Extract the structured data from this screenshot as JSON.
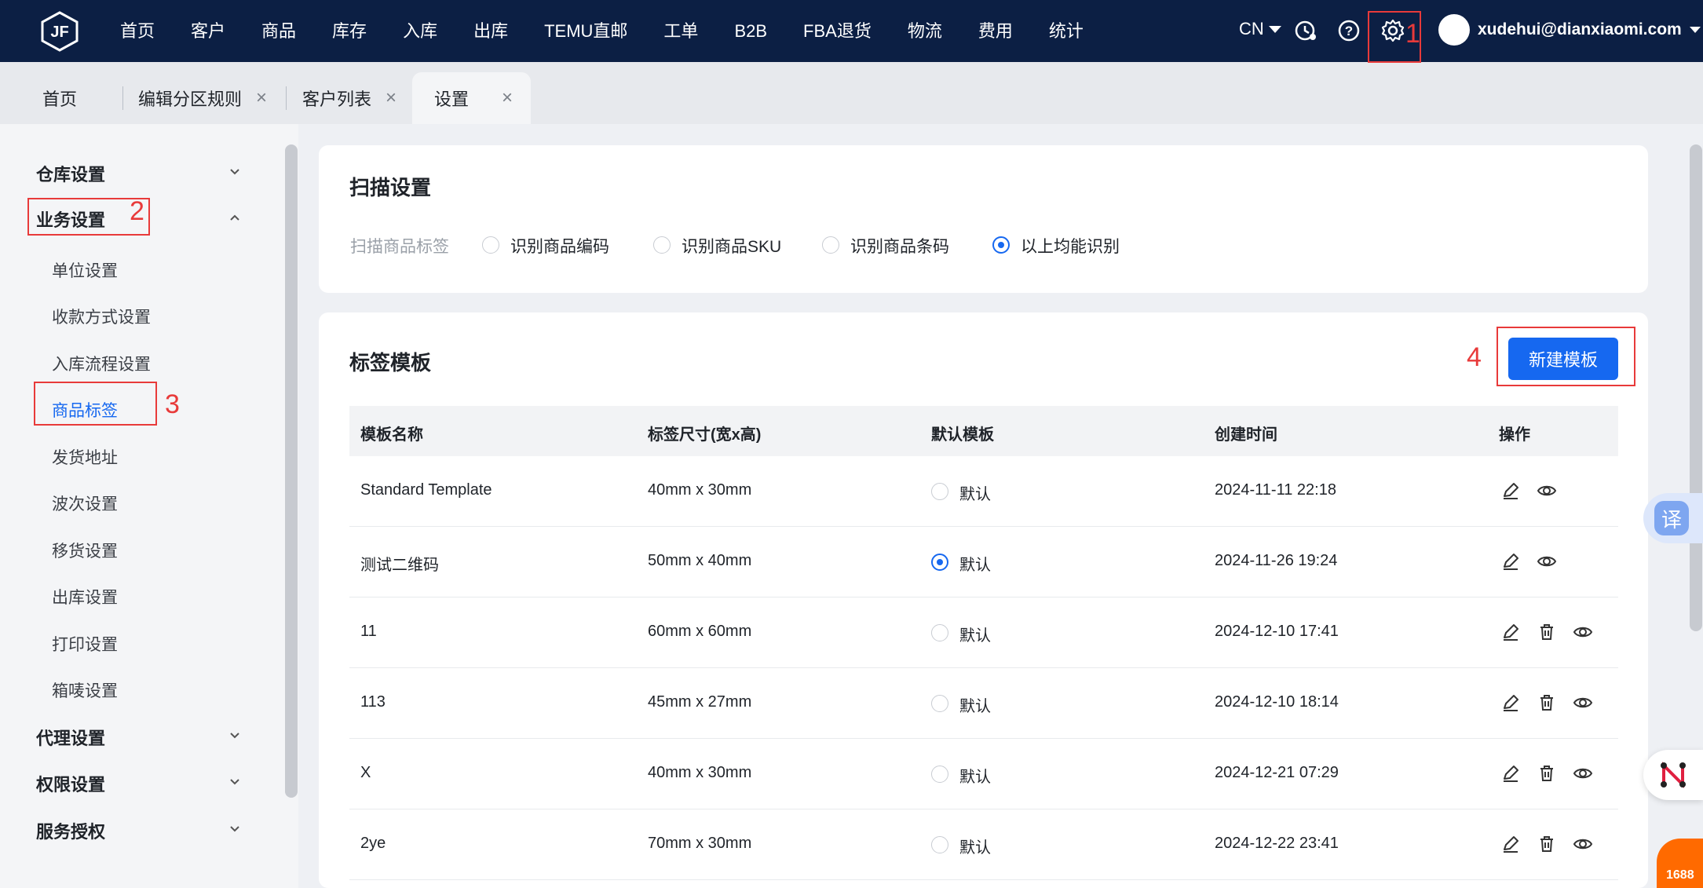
{
  "topbar": {
    "logo_text": "JF",
    "nav": [
      "首页",
      "客户",
      "商品",
      "库存",
      "入库",
      "出库",
      "TEMU直邮",
      "工单",
      "B2B",
      "FBA退货",
      "物流",
      "费用",
      "统计"
    ],
    "lang": "CN",
    "user_email": "xudehui@dianxiaomi.com",
    "icons": [
      "clock-icon",
      "help-icon",
      "gear-icon"
    ]
  },
  "tabs": [
    {
      "label": "首页",
      "closable": false
    },
    {
      "label": "编辑分区规则",
      "closable": true
    },
    {
      "label": "客户列表",
      "closable": true
    },
    {
      "label": "设置",
      "closable": true,
      "active": true
    }
  ],
  "tab_close_glyph": "×",
  "sidebar": {
    "groups": [
      {
        "label": "仓库设置",
        "expanded": false
      },
      {
        "label": "业务设置",
        "expanded": true
      },
      {
        "label": "代理设置",
        "expanded": false
      },
      {
        "label": "权限设置",
        "expanded": false
      },
      {
        "label": "服务授权",
        "expanded": false
      }
    ],
    "business_items": [
      "单位设置",
      "收款方式设置",
      "入库流程设置",
      "商品标签",
      "发货地址",
      "波次设置",
      "移货设置",
      "出库设置",
      "打印设置",
      "箱唛设置"
    ],
    "active_item": "商品标签"
  },
  "scan": {
    "title": "扫描设置",
    "label": "扫描商品标签",
    "options": [
      "识别商品编码",
      "识别商品SKU",
      "识别商品条码",
      "以上均能识别"
    ],
    "selected": "以上均能识别"
  },
  "templates": {
    "title": "标签模板",
    "new_button": "新建模板",
    "columns": [
      "模板名称",
      "标签尺寸(宽x高)",
      "默认模板",
      "创建时间",
      "操作"
    ],
    "default_label": "默认",
    "rows": [
      {
        "name": "Standard Template",
        "size": "40mm x 30mm",
        "is_default": false,
        "created": "2024-11-11 22:18",
        "actions": [
          "edit-icon",
          "view-icon"
        ]
      },
      {
        "name": "测试二维码",
        "size": "50mm x 40mm",
        "is_default": true,
        "created": "2024-11-26 19:24",
        "actions": [
          "edit-icon",
          "view-icon"
        ]
      },
      {
        "name": "11",
        "size": "60mm x 60mm",
        "is_default": false,
        "created": "2024-12-10 17:41",
        "actions": [
          "edit-icon",
          "delete-icon",
          "view-icon"
        ]
      },
      {
        "name": "113",
        "size": "45mm x 27mm",
        "is_default": false,
        "created": "2024-12-10 18:14",
        "actions": [
          "edit-icon",
          "delete-icon",
          "view-icon"
        ]
      },
      {
        "name": "X",
        "size": "40mm x 30mm",
        "is_default": false,
        "created": "2024-12-21 07:29",
        "actions": [
          "edit-icon",
          "delete-icon",
          "view-icon"
        ]
      },
      {
        "name": "2ye",
        "size": "70mm x 30mm",
        "is_default": false,
        "created": "2024-12-22 23:41",
        "actions": [
          "edit-icon",
          "delete-icon",
          "view-icon"
        ]
      }
    ]
  },
  "annotations": [
    "1",
    "2",
    "3",
    "4"
  ],
  "floating": {
    "translate": "译",
    "brand": "1688"
  },
  "colors": {
    "nav_bg": "#0c1f44",
    "primary": "#1668f0",
    "annotation": "#e83a3a"
  }
}
